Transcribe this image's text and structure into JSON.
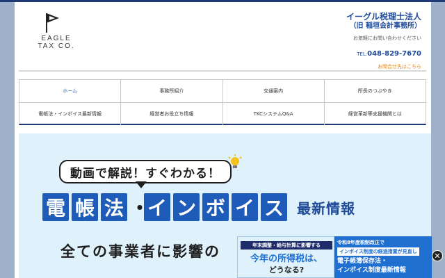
{
  "header": {
    "logo_text_1": "EAGLE",
    "logo_text_2": "TAX CO.",
    "firm_name": "イーグル税理士法人",
    "firm_former": "（旧 稲垣会計事務所）",
    "contact_note": "お気軽にお問い合わせください",
    "tel_label": "TEL:",
    "tel_number": "048-829-7670",
    "inquiry_link": "お問合せ先はこちら"
  },
  "nav": {
    "row1": [
      "ホーム",
      "事務所紹介",
      "交通案内",
      "所長のつぶやき"
    ],
    "row2": [
      "電帳法・インボイス最新情報",
      "経営者お役立ち情報",
      "TKCシステムQ&A",
      "経営革新等支援機関とは"
    ],
    "active": "ホーム"
  },
  "banner": {
    "bubble": "動画で解説！すぐわかる！",
    "title_chars_1": [
      "電",
      "帳",
      "法"
    ],
    "dot": "・",
    "title_chars_2": [
      "イ",
      "ン",
      "ボ",
      "イ",
      "ス"
    ],
    "title_suffix": "最新情報",
    "sub_headline": "全ての事業者に影響の"
  },
  "promo": {
    "card1_top": "年末調整・給与計算に影響する",
    "card1_main": "今年の所得税は、",
    "card1_sub": "どうなる?",
    "card2_top": "令和8年度税制改正で",
    "card2_badge": "インボイス制度の経過措置が見直し",
    "card2_line1": "電子帳簿保存法・",
    "card2_line2": "インボイス制度最新情報"
  },
  "close_symbol": "✕",
  "colors": {
    "brand": "#1f4b99",
    "accent": "#1f5bb8",
    "orange": "#e08a1e"
  }
}
